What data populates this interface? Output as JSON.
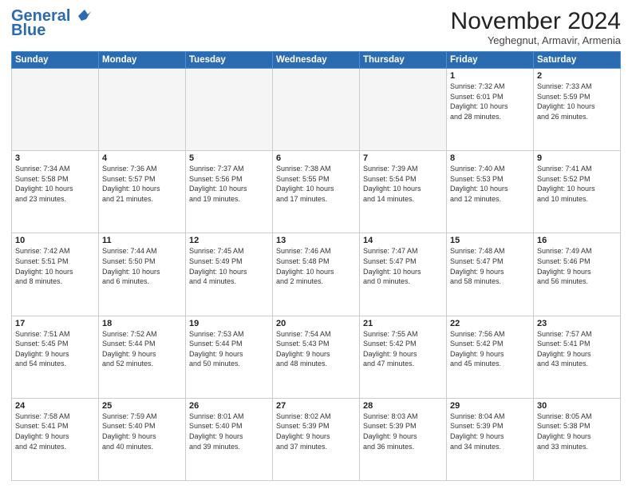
{
  "header": {
    "logo_line1": "General",
    "logo_line2": "Blue",
    "month_title": "November 2024",
    "location": "Yeghegnut, Armavir, Armenia"
  },
  "days_of_week": [
    "Sunday",
    "Monday",
    "Tuesday",
    "Wednesday",
    "Thursday",
    "Friday",
    "Saturday"
  ],
  "weeks": [
    [
      {
        "day": "",
        "info": ""
      },
      {
        "day": "",
        "info": ""
      },
      {
        "day": "",
        "info": ""
      },
      {
        "day": "",
        "info": ""
      },
      {
        "day": "",
        "info": ""
      },
      {
        "day": "1",
        "info": "Sunrise: 7:32 AM\nSunset: 6:01 PM\nDaylight: 10 hours\nand 28 minutes."
      },
      {
        "day": "2",
        "info": "Sunrise: 7:33 AM\nSunset: 5:59 PM\nDaylight: 10 hours\nand 26 minutes."
      }
    ],
    [
      {
        "day": "3",
        "info": "Sunrise: 7:34 AM\nSunset: 5:58 PM\nDaylight: 10 hours\nand 23 minutes."
      },
      {
        "day": "4",
        "info": "Sunrise: 7:36 AM\nSunset: 5:57 PM\nDaylight: 10 hours\nand 21 minutes."
      },
      {
        "day": "5",
        "info": "Sunrise: 7:37 AM\nSunset: 5:56 PM\nDaylight: 10 hours\nand 19 minutes."
      },
      {
        "day": "6",
        "info": "Sunrise: 7:38 AM\nSunset: 5:55 PM\nDaylight: 10 hours\nand 17 minutes."
      },
      {
        "day": "7",
        "info": "Sunrise: 7:39 AM\nSunset: 5:54 PM\nDaylight: 10 hours\nand 14 minutes."
      },
      {
        "day": "8",
        "info": "Sunrise: 7:40 AM\nSunset: 5:53 PM\nDaylight: 10 hours\nand 12 minutes."
      },
      {
        "day": "9",
        "info": "Sunrise: 7:41 AM\nSunset: 5:52 PM\nDaylight: 10 hours\nand 10 minutes."
      }
    ],
    [
      {
        "day": "10",
        "info": "Sunrise: 7:42 AM\nSunset: 5:51 PM\nDaylight: 10 hours\nand 8 minutes."
      },
      {
        "day": "11",
        "info": "Sunrise: 7:44 AM\nSunset: 5:50 PM\nDaylight: 10 hours\nand 6 minutes."
      },
      {
        "day": "12",
        "info": "Sunrise: 7:45 AM\nSunset: 5:49 PM\nDaylight: 10 hours\nand 4 minutes."
      },
      {
        "day": "13",
        "info": "Sunrise: 7:46 AM\nSunset: 5:48 PM\nDaylight: 10 hours\nand 2 minutes."
      },
      {
        "day": "14",
        "info": "Sunrise: 7:47 AM\nSunset: 5:47 PM\nDaylight: 10 hours\nand 0 minutes."
      },
      {
        "day": "15",
        "info": "Sunrise: 7:48 AM\nSunset: 5:47 PM\nDaylight: 9 hours\nand 58 minutes."
      },
      {
        "day": "16",
        "info": "Sunrise: 7:49 AM\nSunset: 5:46 PM\nDaylight: 9 hours\nand 56 minutes."
      }
    ],
    [
      {
        "day": "17",
        "info": "Sunrise: 7:51 AM\nSunset: 5:45 PM\nDaylight: 9 hours\nand 54 minutes."
      },
      {
        "day": "18",
        "info": "Sunrise: 7:52 AM\nSunset: 5:44 PM\nDaylight: 9 hours\nand 52 minutes."
      },
      {
        "day": "19",
        "info": "Sunrise: 7:53 AM\nSunset: 5:44 PM\nDaylight: 9 hours\nand 50 minutes."
      },
      {
        "day": "20",
        "info": "Sunrise: 7:54 AM\nSunset: 5:43 PM\nDaylight: 9 hours\nand 48 minutes."
      },
      {
        "day": "21",
        "info": "Sunrise: 7:55 AM\nSunset: 5:42 PM\nDaylight: 9 hours\nand 47 minutes."
      },
      {
        "day": "22",
        "info": "Sunrise: 7:56 AM\nSunset: 5:42 PM\nDaylight: 9 hours\nand 45 minutes."
      },
      {
        "day": "23",
        "info": "Sunrise: 7:57 AM\nSunset: 5:41 PM\nDaylight: 9 hours\nand 43 minutes."
      }
    ],
    [
      {
        "day": "24",
        "info": "Sunrise: 7:58 AM\nSunset: 5:41 PM\nDaylight: 9 hours\nand 42 minutes."
      },
      {
        "day": "25",
        "info": "Sunrise: 7:59 AM\nSunset: 5:40 PM\nDaylight: 9 hours\nand 40 minutes."
      },
      {
        "day": "26",
        "info": "Sunrise: 8:01 AM\nSunset: 5:40 PM\nDaylight: 9 hours\nand 39 minutes."
      },
      {
        "day": "27",
        "info": "Sunrise: 8:02 AM\nSunset: 5:39 PM\nDaylight: 9 hours\nand 37 minutes."
      },
      {
        "day": "28",
        "info": "Sunrise: 8:03 AM\nSunset: 5:39 PM\nDaylight: 9 hours\nand 36 minutes."
      },
      {
        "day": "29",
        "info": "Sunrise: 8:04 AM\nSunset: 5:39 PM\nDaylight: 9 hours\nand 34 minutes."
      },
      {
        "day": "30",
        "info": "Sunrise: 8:05 AM\nSunset: 5:38 PM\nDaylight: 9 hours\nand 33 minutes."
      }
    ]
  ]
}
